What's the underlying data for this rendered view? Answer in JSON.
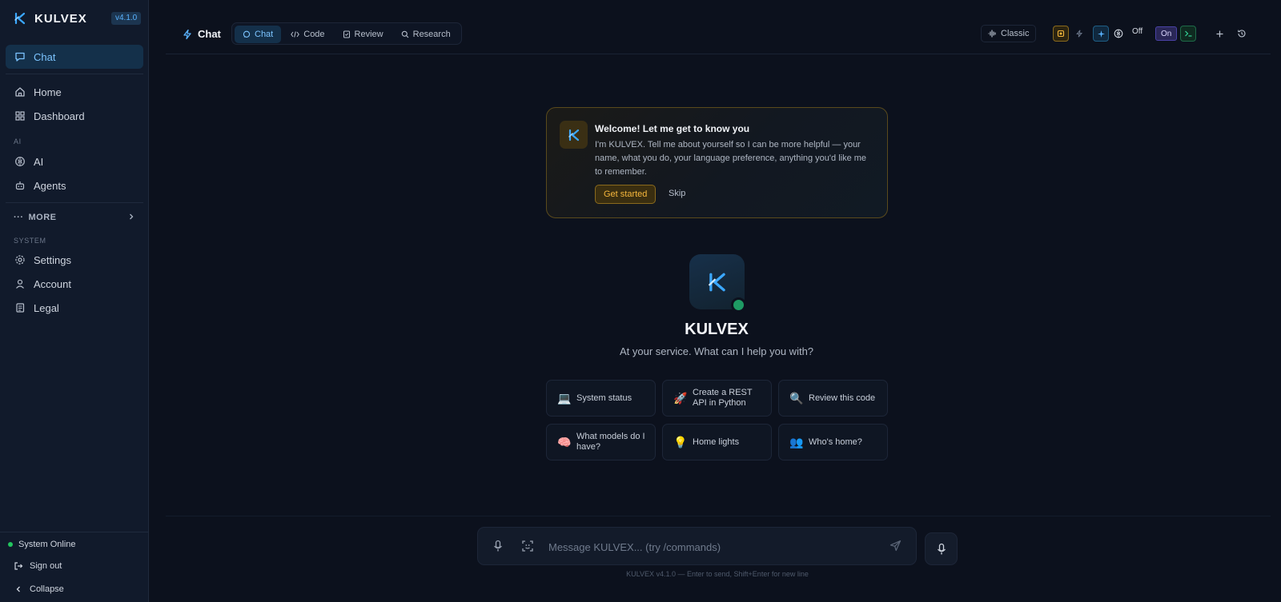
{
  "brand": {
    "name": "KULVEX",
    "version": "v4.1.0"
  },
  "sidebar": {
    "chat": "Chat",
    "home": "Home",
    "dashboard": "Dashboard",
    "section_ai": "AI",
    "ai": "AI",
    "agents": "Agents",
    "more": "MORE",
    "section_system": "SYSTEM",
    "settings": "Settings",
    "account": "Account",
    "legal": "Legal",
    "status": "System Online",
    "sign_out": "Sign out",
    "collapse": "Collapse"
  },
  "topbar": {
    "title": "Chat",
    "tabs": {
      "chat": "Chat",
      "code": "Code",
      "review": "Review",
      "research": "Research"
    },
    "classic": "Classic",
    "off_label": "Off",
    "on_label": "On"
  },
  "welcome": {
    "title": "Welcome! Let me get to know you",
    "description": "I'm KULVEX. Tell me about yourself so I can be more helpful — your name, what you do, your language preference, anything you'd like me to remember.",
    "start": "Get started",
    "skip": "Skip"
  },
  "hero": {
    "name": "KULVEX",
    "subtitle": "At your service. What can I help you with?"
  },
  "suggestions": {
    "s1": {
      "emoji": "💻",
      "label": "System status"
    },
    "s2": {
      "emoji": "🚀",
      "label": "Create a REST API in Python"
    },
    "s3": {
      "emoji": "🔍",
      "label": "Review this code"
    },
    "s4": {
      "emoji": "🧠",
      "label": "What models do I have?"
    },
    "s5": {
      "emoji": "💡",
      "label": "Home lights"
    },
    "s6": {
      "emoji": "👥",
      "label": "Who's home?"
    }
  },
  "input": {
    "placeholder": "Message KULVEX... (try /commands)",
    "hint": "KULVEX v4.1.0 — Enter to send, Shift+Enter for new line"
  },
  "colors": {
    "accent": "#5ab3ff",
    "amber": "#f5b63c",
    "online": "#22c55e"
  }
}
